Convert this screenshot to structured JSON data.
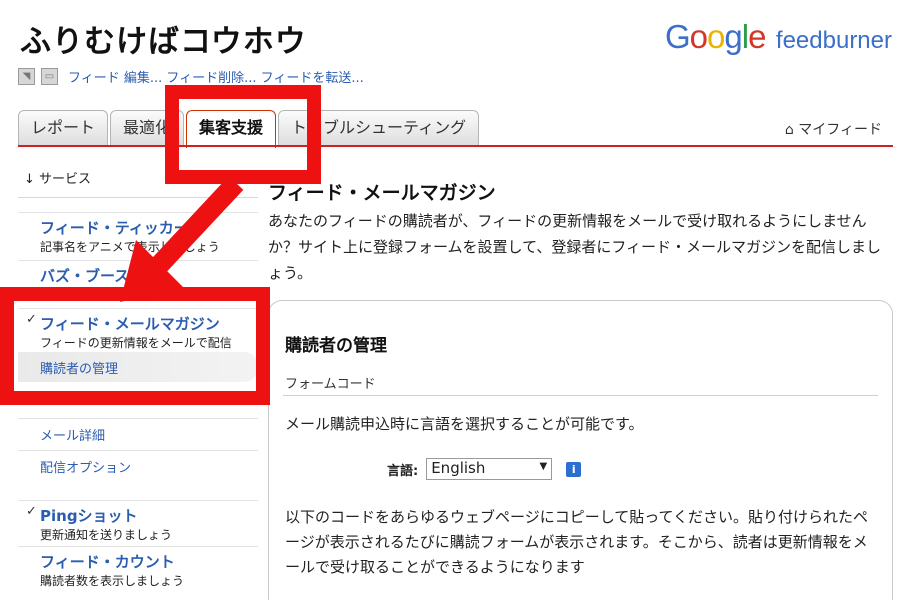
{
  "site": {
    "title": "ふりむけばコウホウ"
  },
  "logo": {
    "google": "Google",
    "product": "feedburner"
  },
  "toolbar": {
    "links": "フィード 編集... フィード削除... フィードを転送..."
  },
  "tabs": [
    {
      "label": "レポート"
    },
    {
      "label": "最適化"
    },
    {
      "label": "集客支援",
      "active": true
    },
    {
      "label": "トラブルシューティング"
    }
  ],
  "myfeed": {
    "label": "マイフィード"
  },
  "sidebar": {
    "heading": "↓ サービス",
    "items": [
      {
        "title": "フィード・ティッカー",
        "desc": "記事名をアニメで表示しましょう"
      },
      {
        "title": "バズ・ブースト",
        "desc": ""
      },
      {
        "title": "フィード・メールマガジン",
        "desc": "フィードの更新情報をメールで配信",
        "checked": true
      },
      {
        "sub": "購読者の管理"
      },
      {
        "sub": "メール詳細"
      },
      {
        "sub": "配信オプション"
      },
      {
        "title": "Pingショット",
        "desc": "更新通知を送りましょう",
        "checked": true
      },
      {
        "title": "フィード・カウント",
        "desc": "購読者数を表示しましょう"
      }
    ]
  },
  "main": {
    "title": "フィード・メールマガジン",
    "description": "あなたのフィードの購読者が、フィードの更新情報をメールで受け取れるようにしませんか？サイト上に登録フォームを設置して、登録者にフィード・メールマガジンを配信しましょう。",
    "panel": {
      "title": "購読者の管理",
      "subtitle": "フォームコード",
      "text": "メール購読申込時に言語を選択することが可能です。",
      "language_label": "言語:",
      "language_value": "English",
      "code_text": "以下のコードをあらゆるウェブページにコピーして貼ってください。貼り付けられたページが表示されるたびに購読フォームが表示されます。そこから、読者は更新情報をメールで受け取ることができるようになります"
    }
  },
  "colors": {
    "accent": "#d02020",
    "link": "#2a5db0",
    "annotation": "#ee1111"
  }
}
